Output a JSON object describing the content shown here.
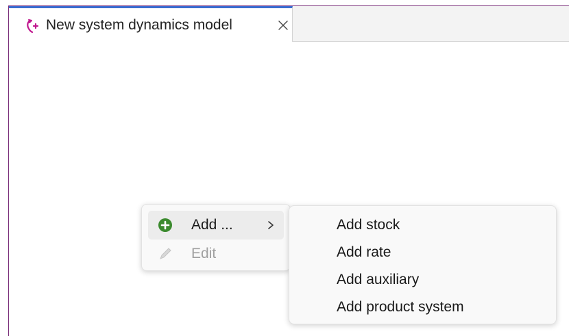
{
  "tab": {
    "title": "New system dynamics model",
    "icon": "system-dynamics-model-icon",
    "close_icon": "close-icon",
    "accent": "#3a6bd0"
  },
  "context_menu": {
    "items": [
      {
        "label": "Add ...",
        "icon": "add-circle-icon",
        "has_submenu": true,
        "enabled": true
      },
      {
        "label": "Edit",
        "icon": "pencil-icon",
        "enabled": false
      }
    ]
  },
  "submenu": {
    "items": [
      {
        "label": "Add stock"
      },
      {
        "label": "Add rate"
      },
      {
        "label": "Add auxiliary"
      },
      {
        "label": "Add product system"
      }
    ]
  },
  "colors": {
    "add_icon_green": "#3b8a2e",
    "window_border": "#7a2f7a",
    "tab_icon_magenta": "#c0188f"
  }
}
